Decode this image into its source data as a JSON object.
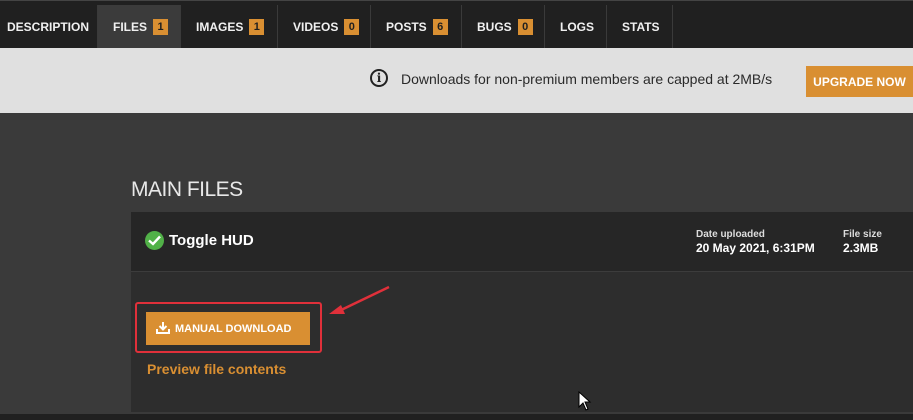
{
  "tabs": [
    {
      "label": "DESCRIPTION",
      "count": null,
      "active": false
    },
    {
      "label": "FILES",
      "count": "1",
      "active": true
    },
    {
      "label": "IMAGES",
      "count": "1",
      "active": false
    },
    {
      "label": "VIDEOS",
      "count": "0",
      "active": false
    },
    {
      "label": "POSTS",
      "count": "6",
      "active": false
    },
    {
      "label": "BUGS",
      "count": "0",
      "active": false
    },
    {
      "label": "LOGS",
      "count": null,
      "active": false
    },
    {
      "label": "STATS",
      "count": null,
      "active": false
    }
  ],
  "notice": {
    "icon": "info-icon",
    "text": "Downloads for non-premium members are capped at 2MB/s",
    "button": "UPGRADE NOW"
  },
  "main": {
    "section_title": "MAIN FILES",
    "file": {
      "name": "Toggle HUD",
      "status_icon": "check-circle-icon",
      "date_label": "Date uploaded",
      "date_value": "20 May 2021, 6:31PM",
      "size_label": "File size",
      "size_value": "2.3MB",
      "download_button": "MANUAL DOWNLOAD",
      "preview_link": "Preview file contents"
    }
  },
  "colors": {
    "accent": "#d98f32",
    "highlight": "#e0303a",
    "check": "#51b148"
  }
}
